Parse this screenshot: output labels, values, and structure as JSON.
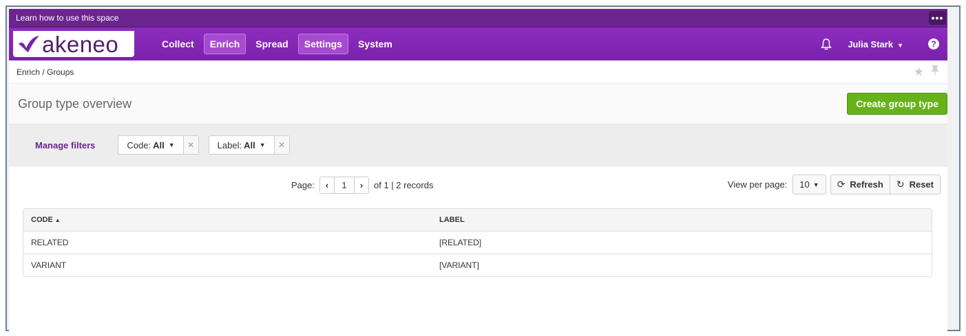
{
  "infobar": {
    "text": "Learn how to use this space",
    "menu_glyph": "•••"
  },
  "logo": {
    "text": "akeneo"
  },
  "nav": {
    "items": [
      {
        "label": "Collect",
        "active": false
      },
      {
        "label": "Enrich",
        "active": true
      },
      {
        "label": "Spread",
        "active": false
      },
      {
        "label": "Settings",
        "active": true
      },
      {
        "label": "System",
        "active": false
      }
    ],
    "user": "Julia Stark",
    "help_glyph": "?"
  },
  "breadcrumb": "Enrich / Groups",
  "page": {
    "title": "Group type overview",
    "create_button": "Create group type"
  },
  "filters": {
    "manage_label": "Manage filters",
    "items": [
      {
        "name": "Code:",
        "value": "All"
      },
      {
        "name": "Label:",
        "value": "All"
      }
    ]
  },
  "pagination": {
    "page_label": "Page:",
    "current_page": "1",
    "summary": "of 1 | 2 records",
    "view_per_page_label": "View per page:",
    "per_page_value": "10",
    "refresh_label": "Refresh",
    "reset_label": "Reset"
  },
  "table": {
    "columns": [
      "CODE",
      "LABEL"
    ],
    "rows": [
      [
        "RELATED",
        "[RELATED]"
      ],
      [
        "VARIANT",
        "[VARIANT]"
      ]
    ]
  },
  "colors": {
    "brand_purple": "#7a22aa",
    "infobar_purple": "#6b2490",
    "create_green": "#67b21a"
  }
}
